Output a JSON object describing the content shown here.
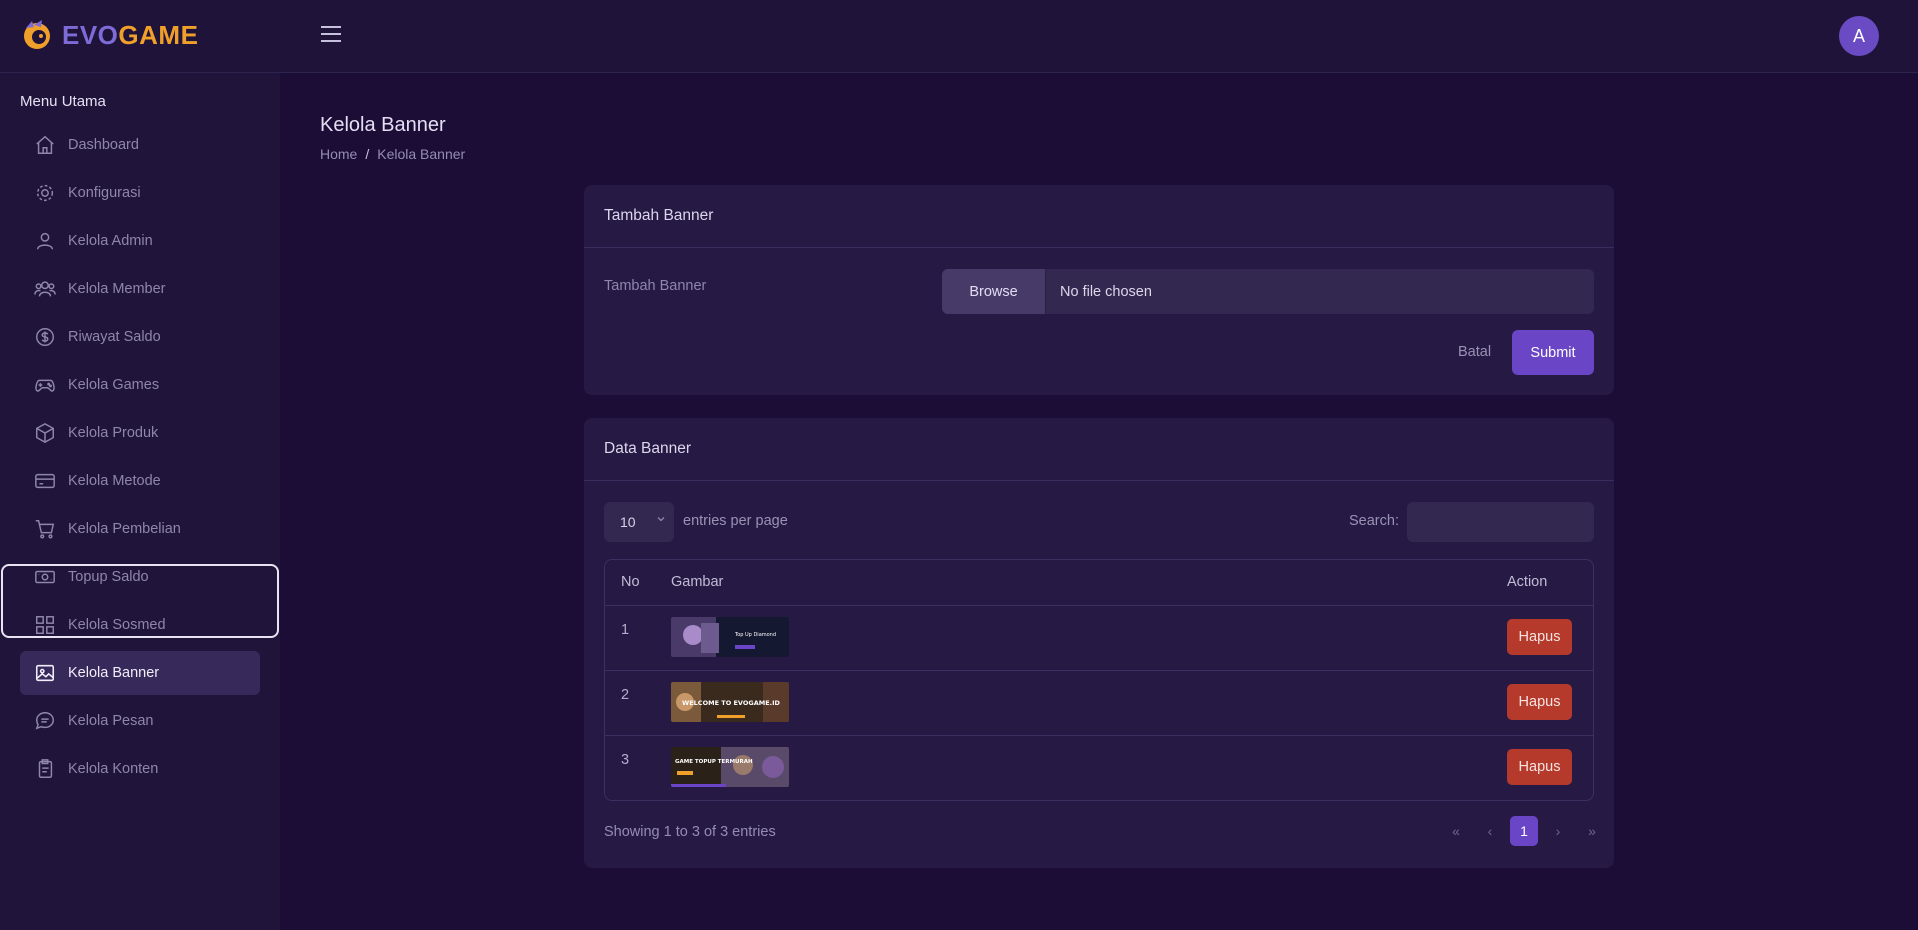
{
  "brand": {
    "part1": "EVO",
    "part2": "GAME"
  },
  "user": {
    "avatar_initial": "A"
  },
  "sidebar": {
    "title": "Menu Utama",
    "items": [
      {
        "label": "Dashboard",
        "icon": "home-icon"
      },
      {
        "label": "Konfigurasi",
        "icon": "gear-icon"
      },
      {
        "label": "Kelola Admin",
        "icon": "user-icon"
      },
      {
        "label": "Kelola Member",
        "icon": "users-icon"
      },
      {
        "label": "Riwayat Saldo",
        "icon": "dollar-icon"
      },
      {
        "label": "Kelola Games",
        "icon": "gamepad-icon"
      },
      {
        "label": "Kelola Produk",
        "icon": "box-icon"
      },
      {
        "label": "Kelola Metode",
        "icon": "card-icon"
      },
      {
        "label": "Kelola Pembelian",
        "icon": "cart-icon"
      },
      {
        "label": "Topup Saldo",
        "icon": "cash-icon"
      },
      {
        "label": "Kelola Sosmed",
        "icon": "grid-icon"
      },
      {
        "label": "Kelola Banner",
        "icon": "image-icon",
        "active": true
      },
      {
        "label": "Kelola Pesan",
        "icon": "chat-icon"
      },
      {
        "label": "Kelola Konten",
        "icon": "document-icon"
      }
    ]
  },
  "page": {
    "title": "Kelola Banner",
    "breadcrumb": {
      "home": "Home",
      "separator": "/",
      "current": "Kelola Banner"
    }
  },
  "add_form": {
    "title": "Tambah Banner",
    "field_label": "Tambah Banner",
    "browse_label": "Browse",
    "file_status": "No file chosen",
    "cancel_label": "Batal",
    "submit_label": "Submit"
  },
  "data_table": {
    "title": "Data Banner",
    "page_size": "10",
    "entries_label": "entries per page",
    "search_label": "Search:",
    "columns": {
      "no": "No",
      "image": "Gambar",
      "action": "Action"
    },
    "rows": [
      {
        "no": "1",
        "thumb_text": "Top Up Diamond",
        "delete_label": "Hapus"
      },
      {
        "no": "2",
        "thumb_text": "WELCOME TO EVOGAME.ID",
        "delete_label": "Hapus"
      },
      {
        "no": "3",
        "thumb_text": "GAME TOPUP TERMURAH",
        "delete_label": "Hapus"
      }
    ],
    "showing": "Showing 1 to 3 of 3 entries",
    "pagination": {
      "first": "«",
      "prev": "‹",
      "current": "1",
      "next": "›",
      "last": "»"
    }
  },
  "colors": {
    "background": "#1b0d35",
    "accent": "#6a45c6",
    "danger": "#b53a2c",
    "brand_orange": "#f0a02a"
  }
}
